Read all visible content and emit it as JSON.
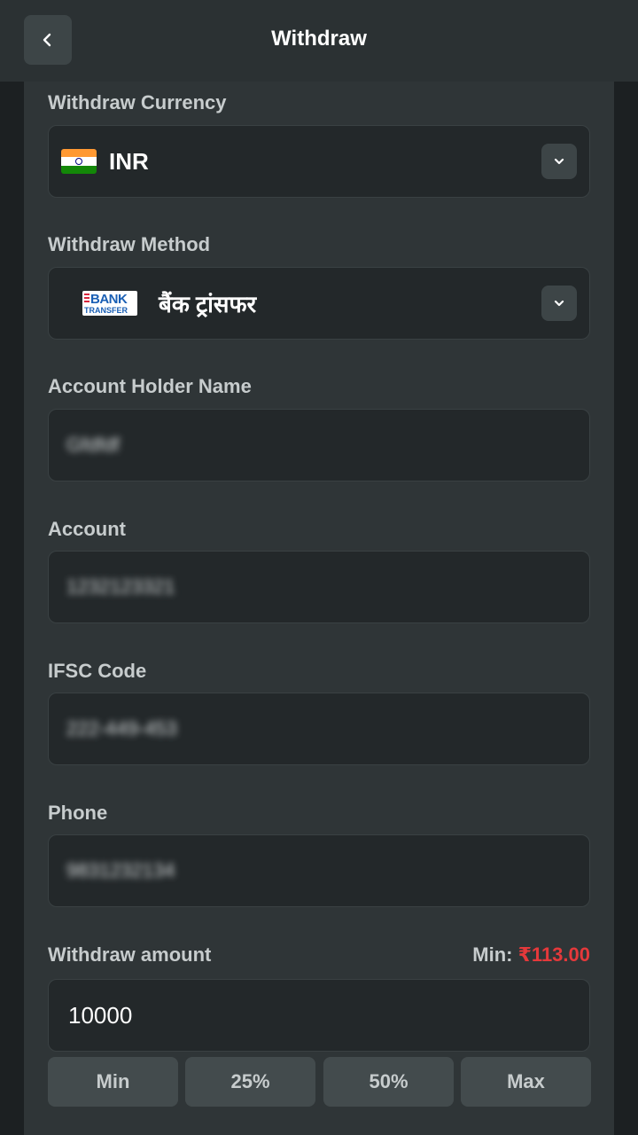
{
  "header": {
    "title": "Withdraw"
  },
  "currency": {
    "label": "Withdraw Currency",
    "value": "INR"
  },
  "method": {
    "label": "Withdraw Method",
    "value": "बैंक ट्रांसफर",
    "logo_top": "BANK",
    "logo_bottom": "TRANSFER"
  },
  "holder": {
    "label": "Account Holder Name",
    "value": "Gfdfdf"
  },
  "account": {
    "label": "Account",
    "value": "1232123321"
  },
  "ifsc": {
    "label": "IFSC Code",
    "value": "222-449-453"
  },
  "phone": {
    "label": "Phone",
    "value": "9831232134"
  },
  "amount": {
    "label": "Withdraw amount",
    "min_prefix": "Min: ",
    "min_value": "₹113.00",
    "value": "10000",
    "quick": [
      "Min",
      "25%",
      "50%",
      "Max"
    ]
  },
  "colors": {
    "accent_red": "#e5393b",
    "background": "#1c2022",
    "panel": "#2f3537"
  }
}
